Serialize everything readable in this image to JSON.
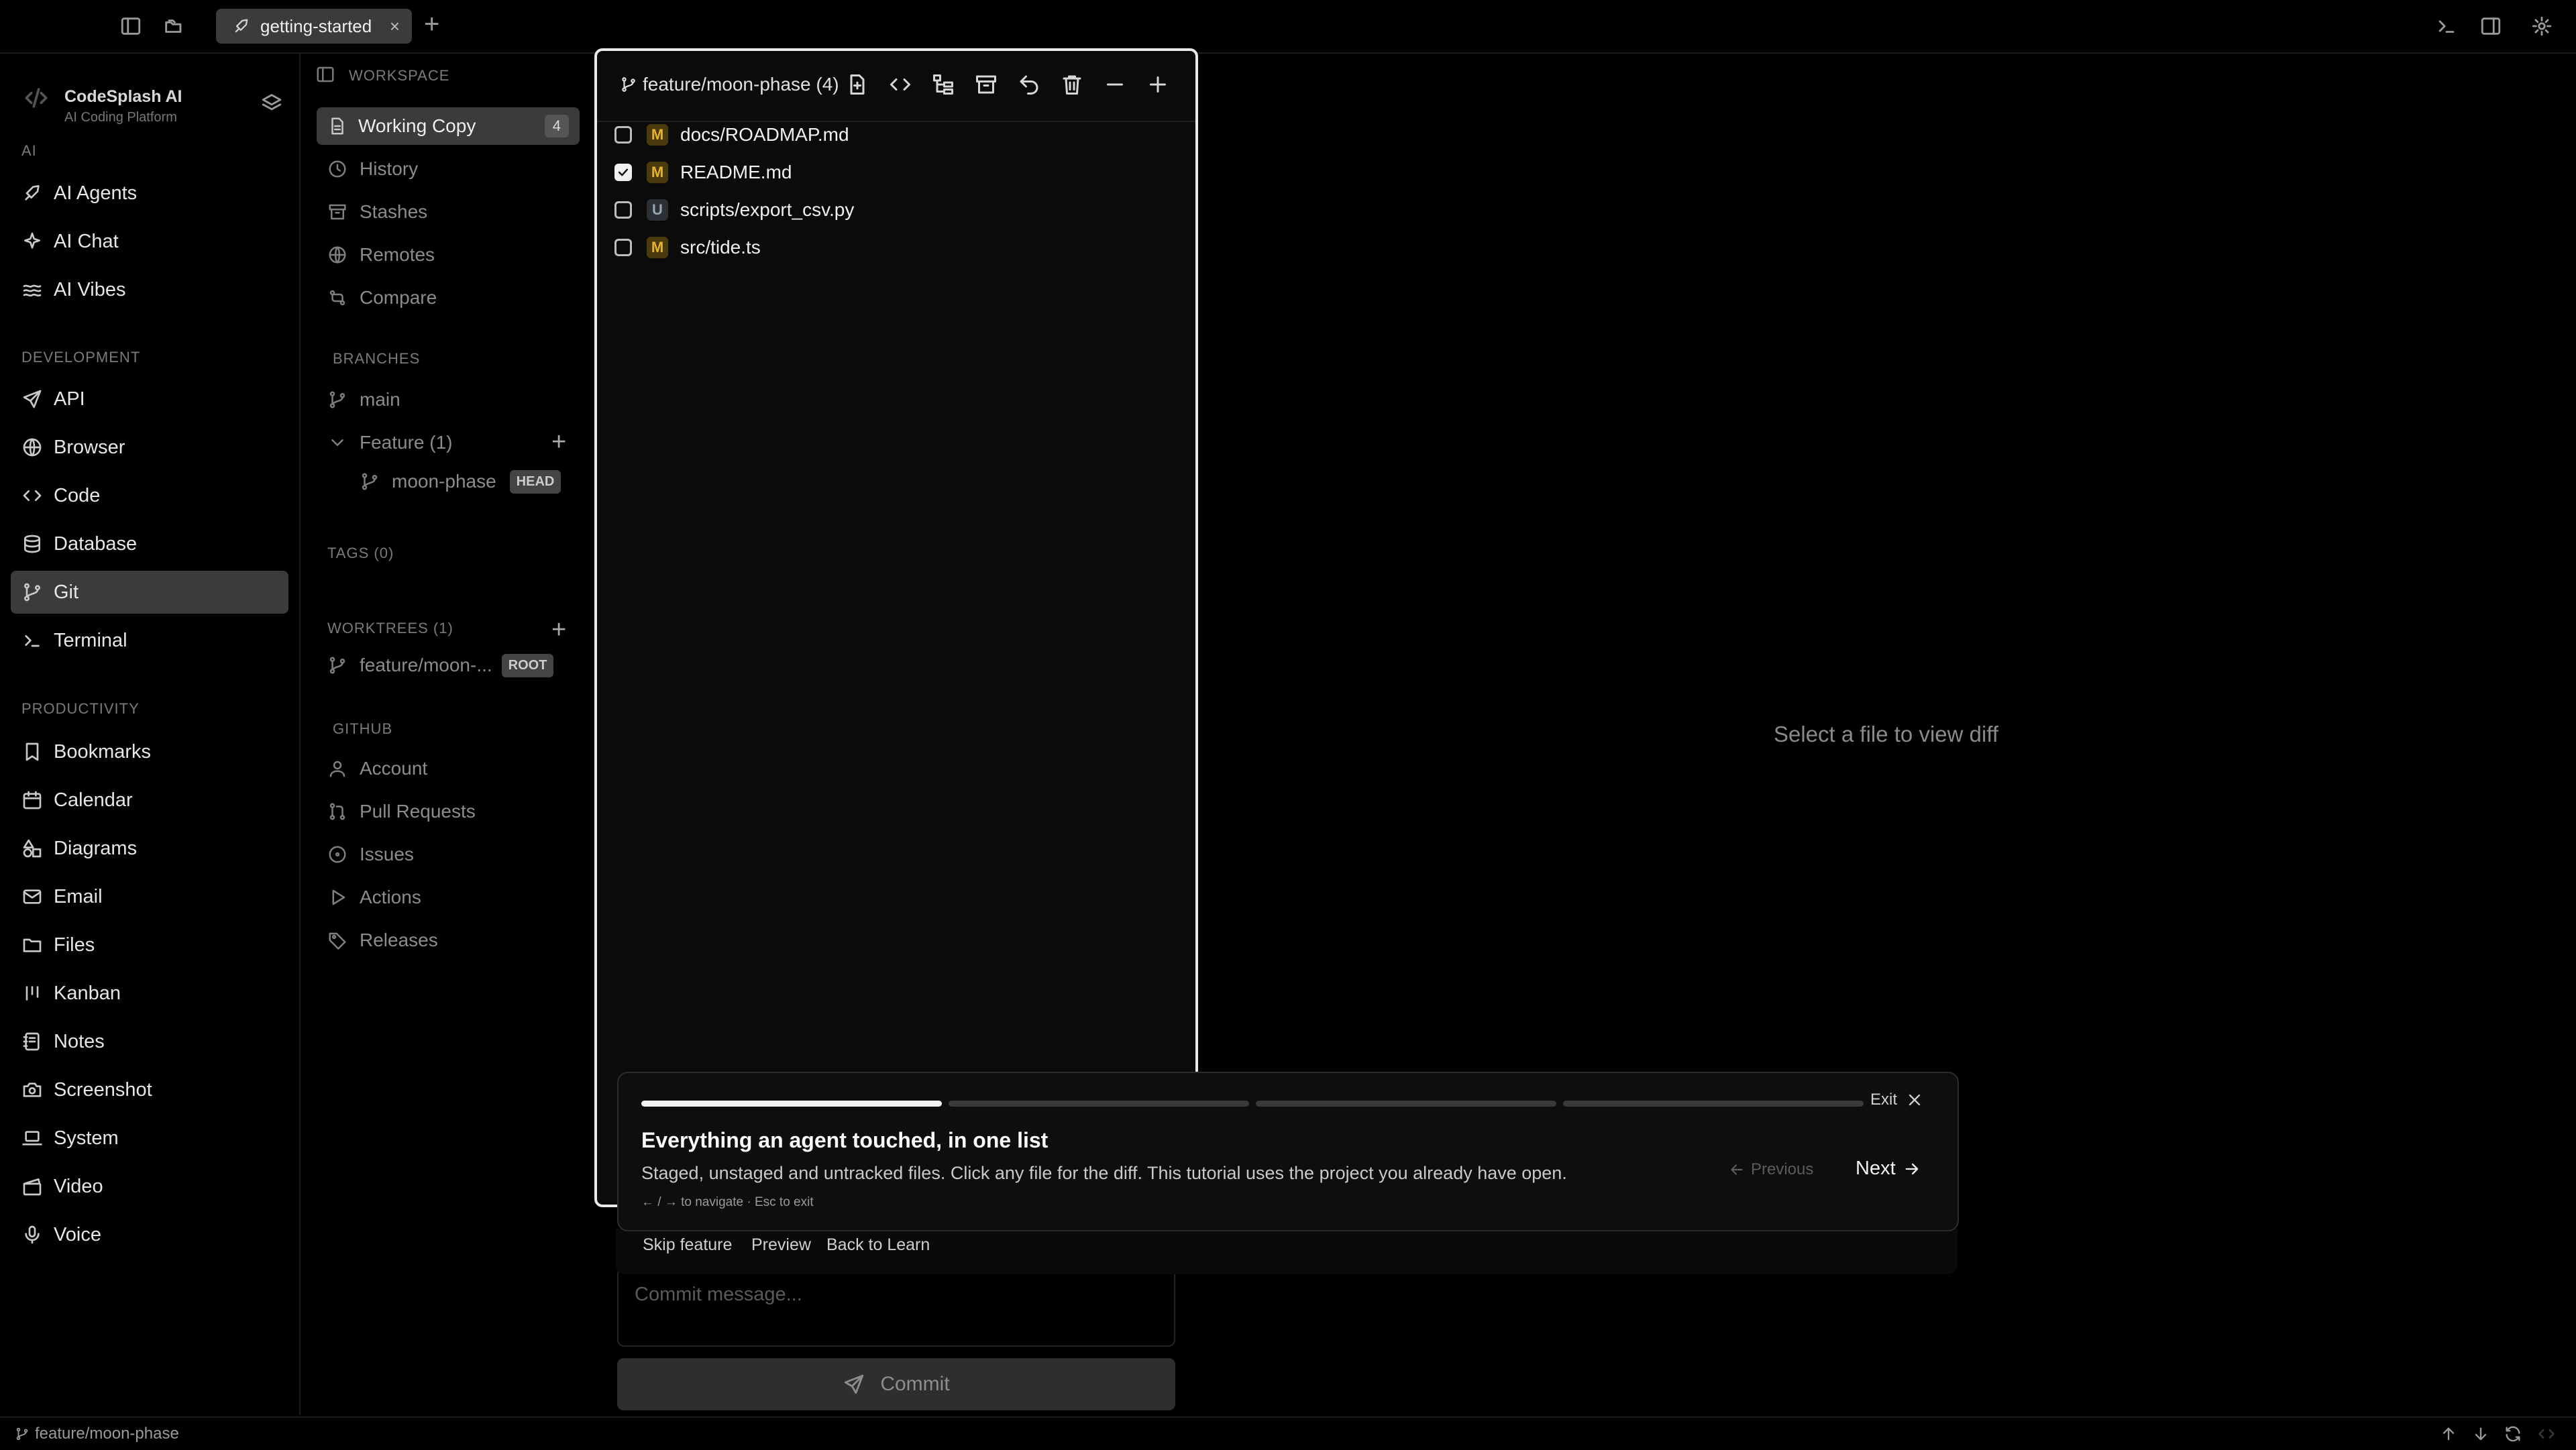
{
  "topbar": {
    "tab_label": "getting-started",
    "tab_close": "×",
    "add_tab": "+"
  },
  "brand": {
    "name": "CodeSplash AI",
    "subtitle": "AI Coding Platform"
  },
  "sidebar": {
    "sections": [
      {
        "title": "AI",
        "items": [
          {
            "label": "AI Agents",
            "icon": "rocket-icon"
          },
          {
            "label": "AI Chat",
            "icon": "sparkles-icon"
          },
          {
            "label": "AI Vibes",
            "icon": "waves-icon"
          }
        ]
      },
      {
        "title": "DEVELOPMENT",
        "items": [
          {
            "label": "API",
            "icon": "send-icon"
          },
          {
            "label": "Browser",
            "icon": "globe-icon"
          },
          {
            "label": "Code",
            "icon": "code-icon"
          },
          {
            "label": "Database",
            "icon": "database-icon"
          },
          {
            "label": "Git",
            "icon": "git-branch-icon",
            "active": true
          },
          {
            "label": "Terminal",
            "icon": "terminal-icon"
          }
        ]
      },
      {
        "title": "PRODUCTIVITY",
        "items": [
          {
            "label": "Bookmarks",
            "icon": "bookmark-icon"
          },
          {
            "label": "Calendar",
            "icon": "calendar-icon"
          },
          {
            "label": "Diagrams",
            "icon": "shapes-icon"
          },
          {
            "label": "Email",
            "icon": "mail-icon"
          },
          {
            "label": "Files",
            "icon": "folder-icon"
          },
          {
            "label": "Kanban",
            "icon": "kanban-icon"
          },
          {
            "label": "Notes",
            "icon": "notebook-icon"
          },
          {
            "label": "Screenshot",
            "icon": "camera-icon"
          },
          {
            "label": "System",
            "icon": "laptop-icon"
          },
          {
            "label": "Video",
            "icon": "clapperboard-icon"
          },
          {
            "label": "Voice",
            "icon": "mic-icon"
          }
        ]
      }
    ]
  },
  "git": {
    "workspace_heading": "WORKSPACE",
    "workspace": [
      {
        "label": "Working Copy",
        "count": "4"
      },
      {
        "label": "History"
      },
      {
        "label": "Stashes"
      },
      {
        "label": "Remotes"
      },
      {
        "label": "Compare"
      }
    ],
    "branches_heading": "BRANCHES",
    "branch_main": "main",
    "feature_group": "Feature (1)",
    "feature_branch": "moon-phase",
    "head_badge": "HEAD",
    "tags_heading": "TAGS (0)",
    "worktrees_heading": "WORKTREES (1)",
    "worktree_name": "feature/moon-...",
    "root_badge": "ROOT",
    "github_heading": "GITHUB",
    "github": [
      "Account",
      "Pull Requests",
      "Issues",
      "Actions",
      "Releases"
    ]
  },
  "changes": {
    "branch_label": "feature/moon-phase (4)",
    "files": [
      {
        "status": "M",
        "path": "docs/ROADMAP.md",
        "checked": false
      },
      {
        "status": "M",
        "path": "README.md",
        "checked": true
      },
      {
        "status": "U",
        "path": "scripts/export_csv.py",
        "checked": false
      },
      {
        "status": "M",
        "path": "src/tide.ts",
        "checked": false
      }
    ],
    "commit_placeholder": "Commit message...",
    "commit_button": "Commit"
  },
  "diff": {
    "empty_text": "Select a file to view diff"
  },
  "tour": {
    "progress_segments": 4,
    "current_step": 1,
    "exit_label": "Exit",
    "title": "Everything an agent touched, in one list",
    "description": "Staged, unstaged and untracked files. Click any file for the diff. This tutorial uses the project you already have open.",
    "hint": "← / → to navigate · Esc to exit",
    "prev_label": "Previous",
    "next_label": "Next",
    "links": [
      "Skip feature",
      "Preview",
      "Back to Learn"
    ]
  },
  "statusbar": {
    "branch": "feature/moon-phase"
  },
  "colors": {
    "background": "#000000",
    "active_item": "#3b3b3b",
    "modified": "#e6b32f",
    "untracked": "#9aa3b0"
  }
}
